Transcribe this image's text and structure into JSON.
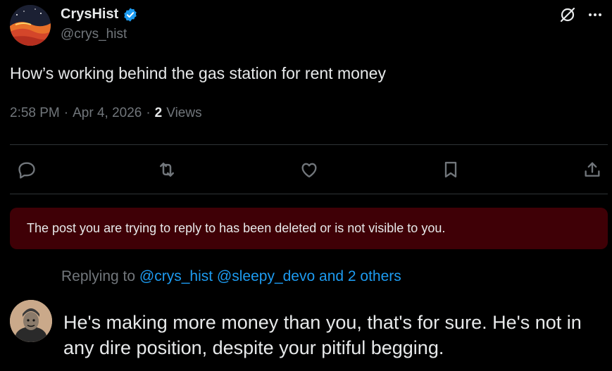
{
  "post": {
    "author_name": "CrysHist",
    "handle": "@crys_hist",
    "text": "How’s working behind the gas station for rent money",
    "time": "2:58 PM",
    "separator": "·",
    "date": "Apr 4, 2026",
    "views_count": "2",
    "views_label": "Views"
  },
  "deleted_banner": {
    "text": "The post you are trying to reply to has been deleted or is not visible to you."
  },
  "reply_context": {
    "prefix": "Replying to ",
    "mention_1": "@crys_hist",
    "mention_2": "@sleepy_devo",
    "others": "and 2 others"
  },
  "composer": {
    "text": "He's making more money than you, that's for sure. He's not in any dire position, despite your pitiful begging."
  },
  "icons": {
    "verified": "verified-badge-icon",
    "grok": "grok-icon",
    "more": "more-icon",
    "reply": "reply-icon",
    "repost": "repost-icon",
    "like": "like-icon",
    "bookmark": "bookmark-icon",
    "share": "share-icon"
  },
  "colors": {
    "background": "#000000",
    "text": "#e7e9ea",
    "muted": "#71767b",
    "accent": "#1d9bf0",
    "banner": "#3f0006"
  }
}
